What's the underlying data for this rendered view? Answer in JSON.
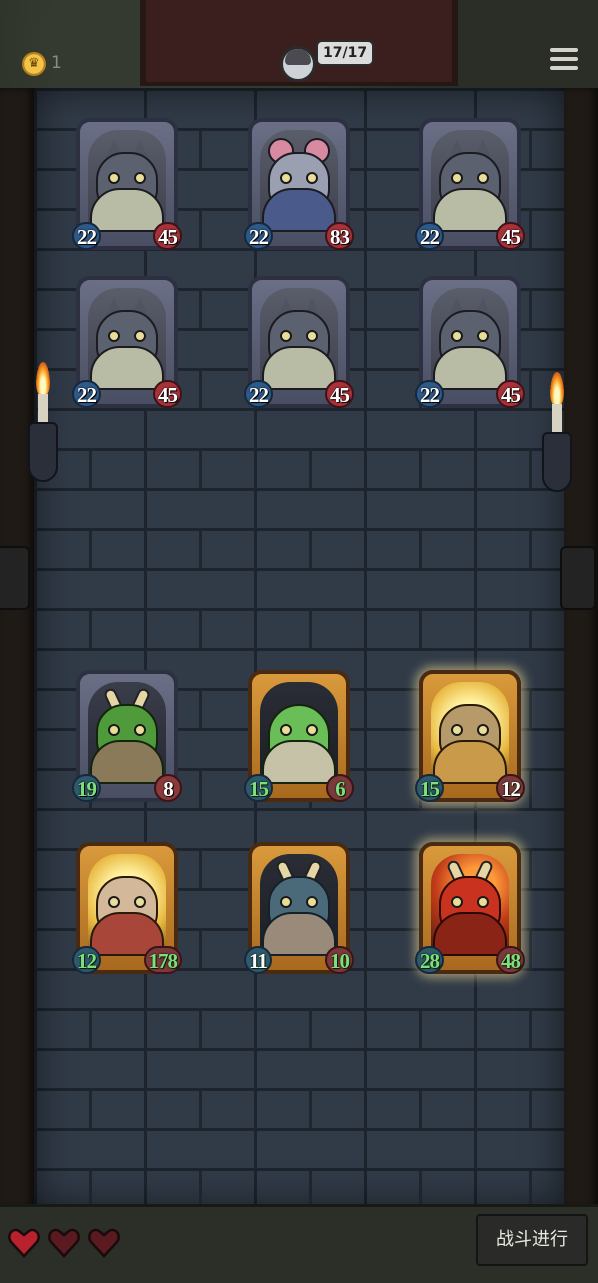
{
  "header": {
    "coin_count": "1",
    "coin_icon": "crown-coin-icon",
    "hero_health": "17/17",
    "menu_icon": "hamburger-menu-icon"
  },
  "enemies": [
    {
      "name_icon": "wolf",
      "attack": "22",
      "health": "45"
    },
    {
      "name_icon": "rat",
      "attack": "22",
      "health": "83"
    },
    {
      "name_icon": "wolf",
      "attack": "22",
      "health": "45"
    },
    {
      "name_icon": "wolf",
      "attack": "22",
      "health": "45"
    },
    {
      "name_icon": "wolf",
      "attack": "22",
      "health": "45"
    },
    {
      "name_icon": "wolf",
      "attack": "22",
      "health": "45"
    }
  ],
  "allies": [
    {
      "name_icon": "horned-crocodile",
      "attack": "19",
      "health": "8"
    },
    {
      "name_icon": "gator",
      "attack": "15",
      "health": "6"
    },
    {
      "name_icon": "mummy",
      "attack": "15",
      "health": "12"
    },
    {
      "name_icon": "dwarf",
      "attack": "12",
      "health": "178"
    },
    {
      "name_icon": "beast",
      "attack": "11",
      "health": "10"
    },
    {
      "name_icon": "demon",
      "attack": "28",
      "health": "48"
    }
  ],
  "lives": {
    "total": 3,
    "icon": "heart-icon"
  },
  "actions": {
    "battle_label": "战斗进行"
  },
  "colors": {
    "enemy_frame": "#6a6f86",
    "ally_frame": "#d99a3c",
    "ally_stat_text": "#7ee07a",
    "attack_badge": "#2e5a8a",
    "health_badge": "#a8323a"
  }
}
